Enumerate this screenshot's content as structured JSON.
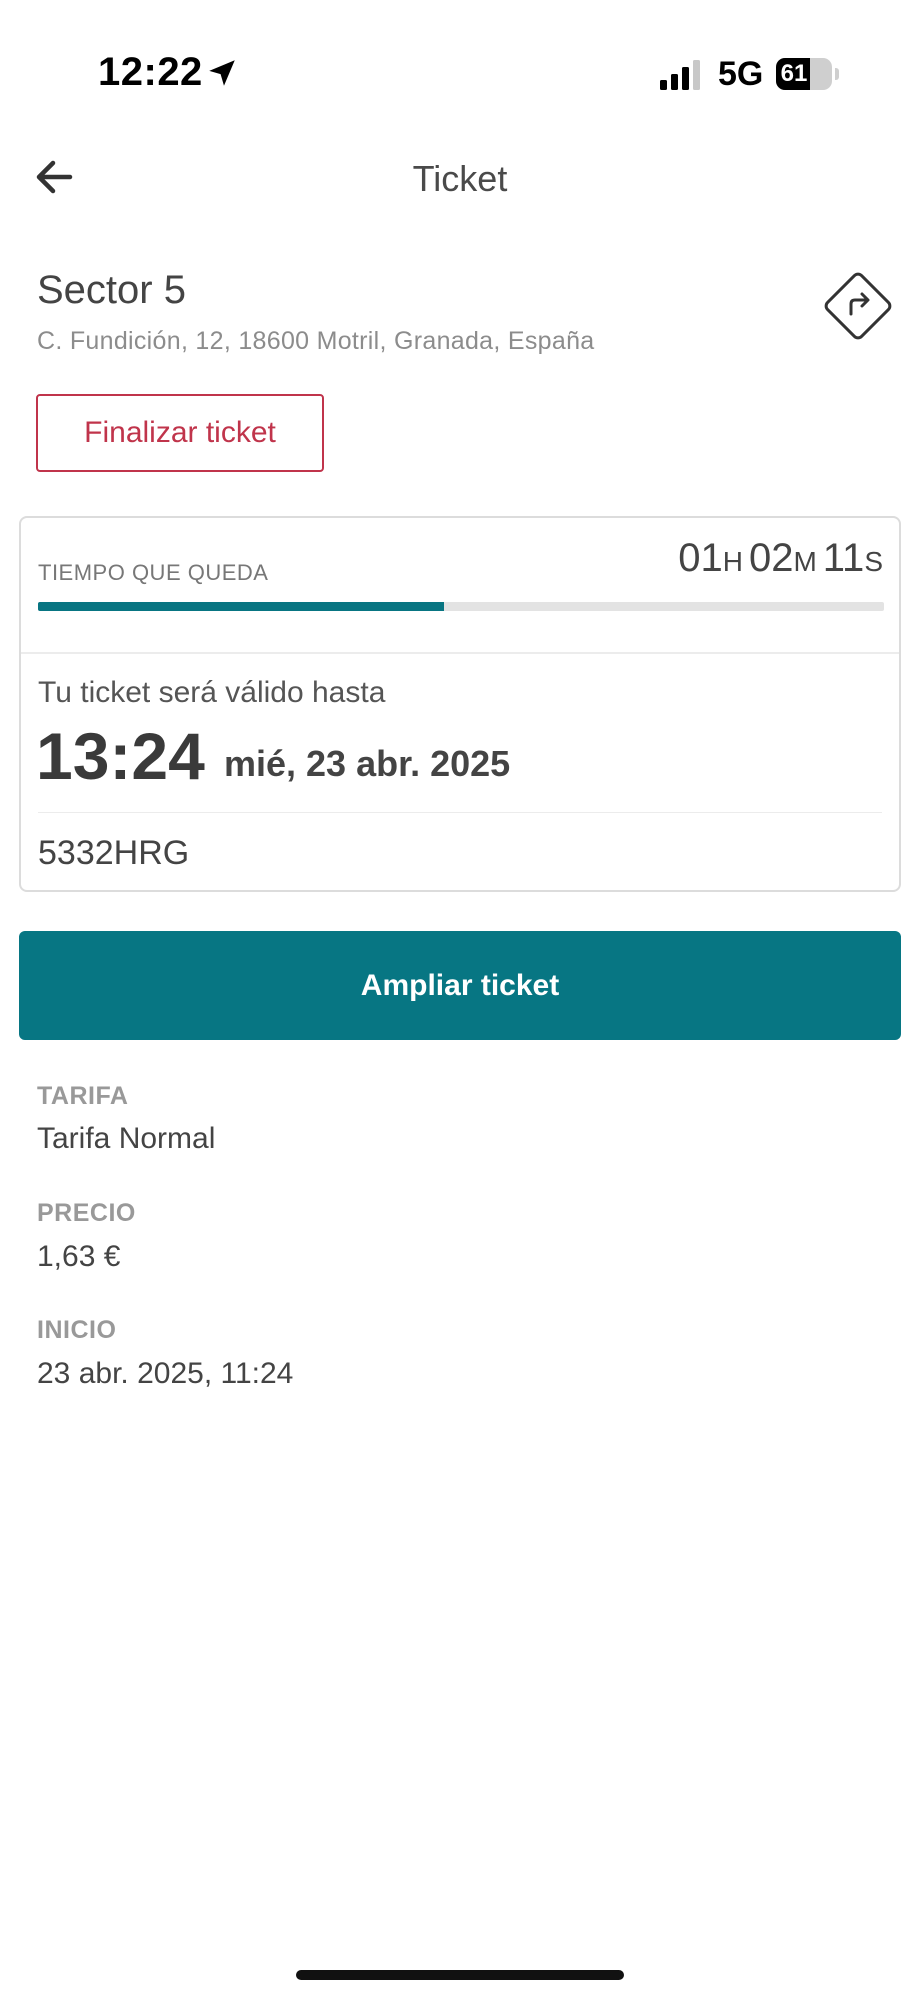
{
  "status_bar": {
    "time": "12:22",
    "network": "5G",
    "battery_level": "61",
    "location_icon": "location-arrow-icon",
    "signal_icon": "cellular-signal-icon"
  },
  "header": {
    "title": "Ticket",
    "back_icon": "arrow-left-icon"
  },
  "location": {
    "name": "Sector 5",
    "address": "C. Fundición, 12, 18600 Motril, Granada, España",
    "directions_icon": "directions-icon"
  },
  "actions": {
    "finish_label": "Finalizar ticket",
    "extend_label": "Ampliar ticket"
  },
  "ticket": {
    "remaining_label": "TIEMPO QUE QUEDA",
    "remaining": {
      "hours": "01",
      "hours_unit": "H",
      "minutes": "02",
      "minutes_unit": "M",
      "seconds": "11",
      "seconds_unit": "S"
    },
    "progress_fraction": 0.48,
    "valid_until_label": "Tu ticket será válido hasta",
    "valid_time": "13:24",
    "valid_date": "mié, 23 abr. 2025",
    "plate": "5332HRG"
  },
  "details": [
    {
      "label": "TARIFA",
      "value": "Tarifa Normal"
    },
    {
      "label": "PRECIO",
      "value": "1,63 €"
    },
    {
      "label": "INICIO",
      "value": "23 abr. 2025, 11:24"
    }
  ],
  "colors": {
    "accent": "#077683",
    "danger": "#c0344b",
    "text": "#444444",
    "muted": "#999999"
  }
}
